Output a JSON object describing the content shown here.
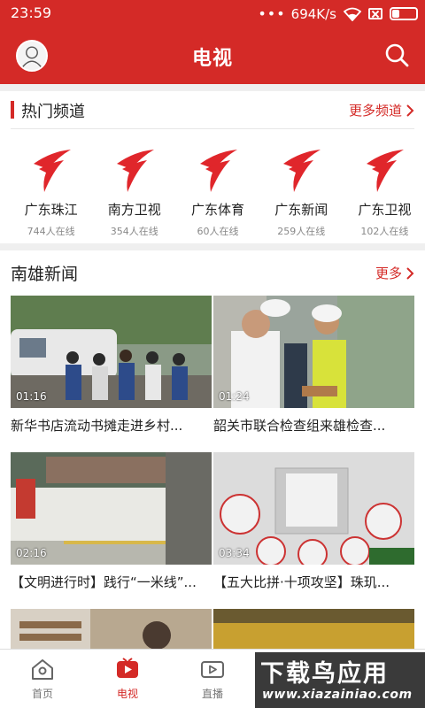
{
  "status_bar": {
    "time": "23:59",
    "speed": "694K/s"
  },
  "header": {
    "title": "电视"
  },
  "hot_channels": {
    "title": "热门频道",
    "more_label": "更多频道",
    "items": [
      {
        "name": "广东珠江",
        "viewers": "744人在线"
      },
      {
        "name": "南方卫视",
        "viewers": "354人在线"
      },
      {
        "name": "广东体育",
        "viewers": "60人在线"
      },
      {
        "name": "广东新闻",
        "viewers": "259人在线"
      },
      {
        "name": "广东卫视",
        "viewers": "102人在线"
      }
    ]
  },
  "news": {
    "title": "南雄新闻",
    "more_label": "更多",
    "items": [
      {
        "duration": "01:16",
        "caption": "新华书店流动书摊走进乡村..."
      },
      {
        "duration": "01:24",
        "caption": "韶关市联合检查组来雄检查..."
      },
      {
        "duration": "02:16",
        "caption": "【文明进行时】践行“一米线”..."
      },
      {
        "duration": "03:34",
        "caption": "【五大比拼·十项攻坚】珠玑..."
      },
      {
        "duration": "",
        "caption": ""
      },
      {
        "duration": "",
        "caption": ""
      }
    ]
  },
  "bottom_nav": [
    {
      "label": "首页"
    },
    {
      "label": "电视"
    },
    {
      "label": "直播"
    },
    {
      "label": ""
    },
    {
      "label": ""
    }
  ],
  "watermark": {
    "text": "下载鸟应用",
    "url": "www.xiazainiao.com"
  },
  "colors": {
    "brand_red": "#d42a27",
    "text": "#222222",
    "muted": "#888888"
  }
}
